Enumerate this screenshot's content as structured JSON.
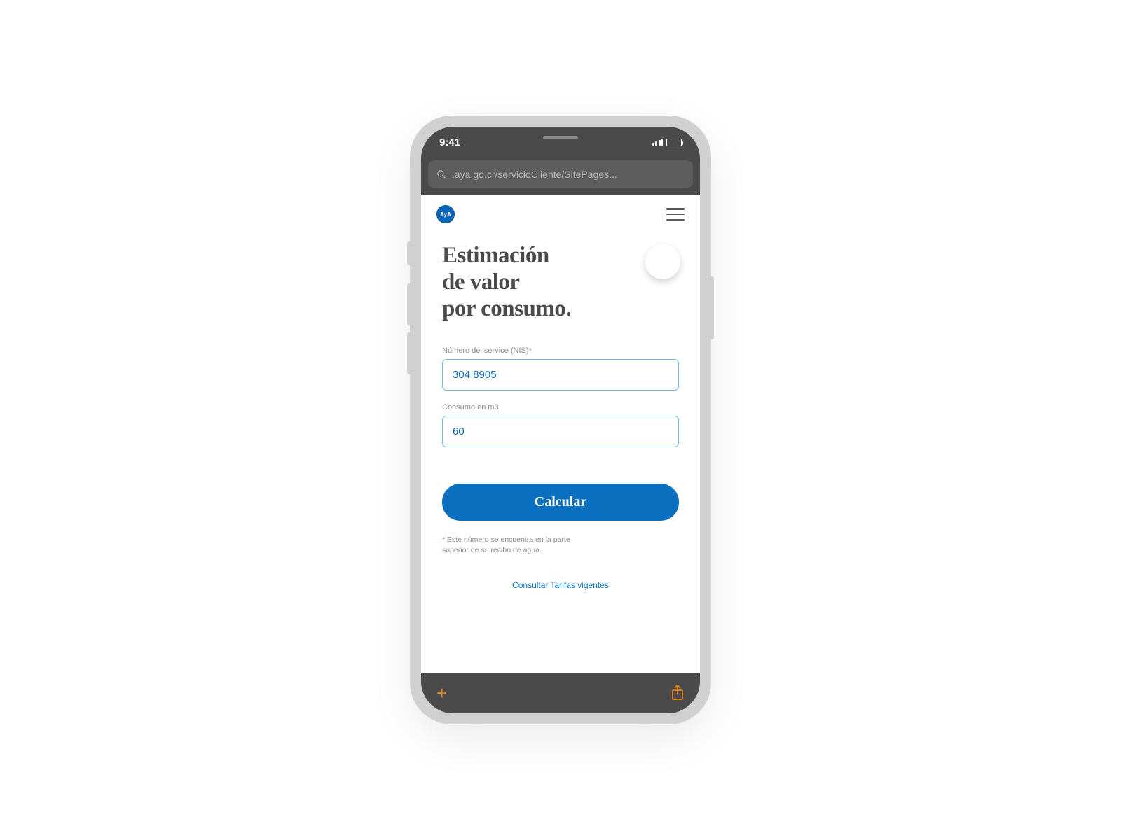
{
  "statusbar": {
    "time": "9:41"
  },
  "browser": {
    "url_text": ".aya.go.cr/servicioCliente/SitePages..."
  },
  "header": {
    "logo_text": "AyA"
  },
  "page": {
    "title_line1": "Estimación",
    "title_line2": "de valor",
    "title_line3": "por consumo."
  },
  "form": {
    "nis_label": "Número del service (NIS)*",
    "nis_value": "304 8905",
    "consumo_label": "Consumo en m3",
    "consumo_value": "60",
    "submit_label": "Calcular"
  },
  "footnote": "* Este número se encuentra en la parte superior de su recibo de agua.",
  "tariff_link": "Consultar Tarifas vigentes"
}
